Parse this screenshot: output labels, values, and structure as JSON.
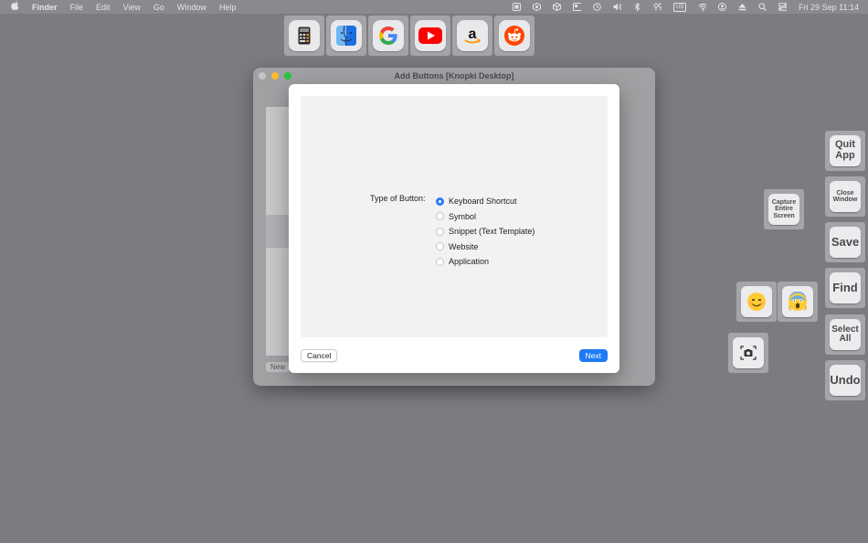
{
  "menubar": {
    "apple": "",
    "app": "Finder",
    "items": [
      "File",
      "Edit",
      "View",
      "Go",
      "Window",
      "Help"
    ],
    "input_source": "US",
    "datetime": "Fri 29 Sep  11:14"
  },
  "top_buttons": [
    {
      "name": "calculator-app-button",
      "icon": "calculator-icon"
    },
    {
      "name": "finder-app-button",
      "icon": "finder-icon"
    },
    {
      "name": "google-website-button",
      "icon": "google-icon"
    },
    {
      "name": "youtube-website-button",
      "icon": "youtube-icon"
    },
    {
      "name": "amazon-website-button",
      "icon": "amazon-icon"
    },
    {
      "name": "reddit-website-button",
      "icon": "reddit-icon"
    }
  ],
  "window": {
    "title": "Add Buttons [Knopki Desktop]",
    "new_label": "New"
  },
  "sheet": {
    "type_label": "Type of Button:",
    "options": [
      {
        "label": "Keyboard Shortcut",
        "checked": true
      },
      {
        "label": "Symbol",
        "checked": false
      },
      {
        "label": "Snippet (Text Template)",
        "checked": false
      },
      {
        "label": "Website",
        "checked": false
      },
      {
        "label": "Application",
        "checked": false
      }
    ],
    "cancel_label": "Cancel",
    "next_label": "Next"
  },
  "side_buttons": {
    "quit": "Quit App",
    "close": "Close Window",
    "capture": "Capture Entire Screen",
    "save": "Save",
    "find": "Find",
    "select_all": "Select All",
    "undo": "Undo",
    "emoji_smile": "😊",
    "emoji_scream": "😱"
  },
  "colors": {
    "desktop": "#7b7b80",
    "accent": "#1f7bf5",
    "close": "#ff5f57",
    "minimize": "#febc2e",
    "zoom": "#28c840"
  }
}
